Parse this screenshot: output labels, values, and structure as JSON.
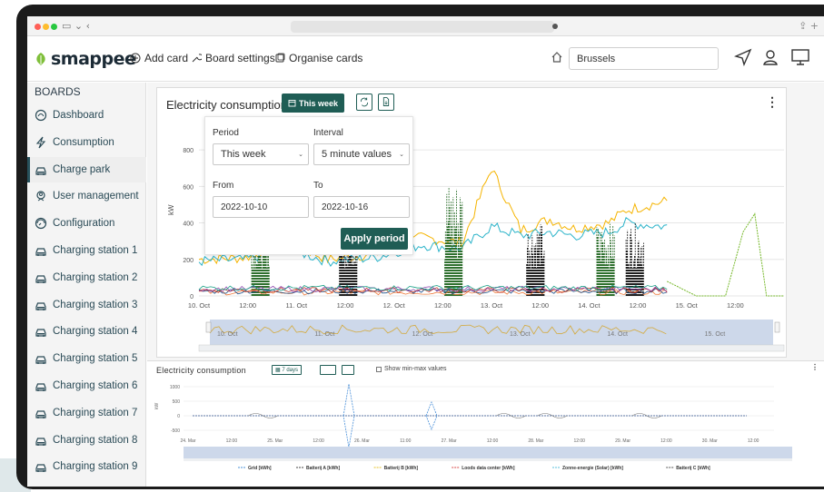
{
  "browser": {},
  "app": {
    "logo": "smappee",
    "toolbar": {
      "add_card": "Add card",
      "board_settings": "Board settings",
      "organise_cards": "Organise cards"
    },
    "location_search": {
      "value": "Brussels"
    }
  },
  "sidebar": {
    "title": "BOARDS",
    "items": [
      {
        "label": "Dashboard",
        "icon": "gauge-icon"
      },
      {
        "label": "Consumption",
        "icon": "bolt-icon"
      },
      {
        "label": "Charge park",
        "icon": "car-icon",
        "active": true
      },
      {
        "label": "User management",
        "icon": "user-badge-icon"
      },
      {
        "label": "Configuration",
        "icon": "config-gauge-icon"
      },
      {
        "label": "Charging station 1",
        "icon": "car-icon"
      },
      {
        "label": "Charging station 2",
        "icon": "car-icon"
      },
      {
        "label": "Charging station 3",
        "icon": "car-icon"
      },
      {
        "label": "Charging station 4",
        "icon": "car-icon"
      },
      {
        "label": "Charging station 5",
        "icon": "car-icon"
      },
      {
        "label": "Charging station 6",
        "icon": "car-icon"
      },
      {
        "label": "Charging station 7",
        "icon": "car-icon"
      },
      {
        "label": "Charging station 8",
        "icon": "car-icon"
      },
      {
        "label": "Charging station 9",
        "icon": "car-icon"
      }
    ]
  },
  "card1": {
    "title": "Electricity consumption",
    "period_button": "This week",
    "popup": {
      "period_label": "Period",
      "period_value": "This week",
      "interval_label": "Interval",
      "interval_value": "5 minute values",
      "from_label": "From",
      "from_value": "2022-10-10",
      "to_label": "To",
      "to_value": "2022-10-16",
      "apply": "Apply period"
    }
  },
  "card2": {
    "title": "Electricity consumption",
    "period_button": "7 days",
    "minmax_label": "Show min-max values"
  },
  "colors": {
    "brand": "#1f5d55",
    "sidebar_text": "#2a4a56",
    "navigator_fill": "#cdd8ea"
  },
  "chart_data": [
    {
      "type": "line",
      "ylabel": "kW",
      "ylim": [
        0,
        900
      ],
      "y_ticks": [
        "0",
        "200",
        "400",
        "600",
        "800"
      ],
      "x_ticks": [
        "10. Oct",
        "12:00",
        "11. Oct",
        "12:00",
        "12. Oct",
        "12:00",
        "13. Oct",
        "12:00",
        "14. Oct",
        "12:00",
        "15. Oct",
        "12:00"
      ],
      "navigator_labels": [
        "10. Oct",
        "11. Oct",
        "12. Oct",
        "13. Oct",
        "14. Oct",
        "15. Oct"
      ],
      "grid": true,
      "series_colors": [
        "#f5b400",
        "#2ab3c9",
        "#222222",
        "#76b82a",
        "#ef7a3a",
        "#1a4f8a",
        "#c0392b",
        "#8e44ad",
        "#16a085"
      ],
      "series": [
        {
          "color": "#f5b400",
          "x": [
            0,
            0.08,
            0.15,
            0.22,
            0.3,
            0.38,
            0.45,
            0.5,
            0.55,
            0.6,
            0.64,
            0.7,
            0.73,
            0.8
          ],
          "values": [
            200,
            210,
            300,
            200,
            230,
            320,
            290,
            700,
            360,
            420,
            370,
            400,
            470,
            520
          ]
        },
        {
          "color": "#2ab3c9",
          "x": [
            0,
            0.08,
            0.15,
            0.22,
            0.3,
            0.38,
            0.45,
            0.5,
            0.55,
            0.6,
            0.64,
            0.7,
            0.73,
            0.8
          ],
          "values": [
            190,
            200,
            260,
            190,
            210,
            280,
            260,
            380,
            330,
            350,
            330,
            350,
            400,
            380
          ]
        },
        {
          "color": "#76b82a",
          "x": [
            0.8,
            0.85,
            0.9,
            0.93,
            0.95,
            0.97,
            1.0
          ],
          "values": [
            80,
            0,
            0,
            350,
            450,
            0,
            0
          ]
        }
      ]
    },
    {
      "type": "line",
      "ylabel": "kW",
      "y_ticks": [
        "1000",
        "500",
        "0",
        "-500"
      ],
      "x_ticks": [
        "24. Mar",
        "12:00",
        "25. Mar",
        "12:00",
        "26. Mar",
        "11:00",
        "27. Mar",
        "12:00",
        "28. Mar",
        "12:00",
        "29. Mar",
        "12:00",
        "30. Mar",
        "12:00"
      ],
      "legend": [
        "Grid [kWh]",
        "Batterij A [kWh]",
        "Batterij B [kWh]",
        "Loods data center [kWh]",
        "Zonne-energie (Solar) [kWh]",
        "Batterij C [kWh]"
      ],
      "legend_colors": [
        "#4a90d9",
        "#444444",
        "#e6c229",
        "#d94a4a",
        "#5bc0de",
        "#555555"
      ],
      "spikes": [
        {
          "x": 0.28,
          "value": 1000
        },
        {
          "x": 0.42,
          "value": 500
        }
      ]
    }
  ]
}
